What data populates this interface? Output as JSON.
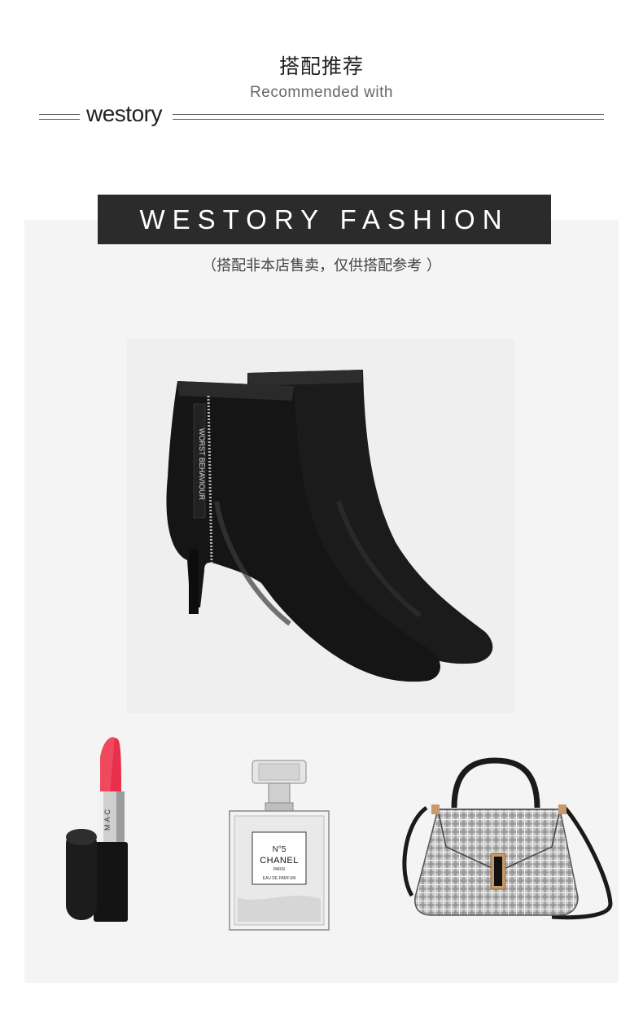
{
  "header": {
    "title": "搭配推荐",
    "subtitle": "Recommended with",
    "brand_logo": "westory"
  },
  "banner": {
    "text": "WESTORY FASHION"
  },
  "note": {
    "text": "（搭配非本店售卖，仅供搭配参考 ）"
  },
  "products": {
    "boots": {
      "zip_tag": "WORST BEHAVIOUR"
    },
    "lipstick": {
      "brand": "M·A·C"
    },
    "perfume": {
      "line1": "N°5",
      "line2": "CHANEL",
      "line3": "PARIS",
      "line4": "EAU DE PARFUM"
    },
    "handbag": {}
  },
  "colors": {
    "panel_bg": "#f4f4f4",
    "banner_bg": "#2b2b2b",
    "lipstick_red": "#e8304a"
  }
}
